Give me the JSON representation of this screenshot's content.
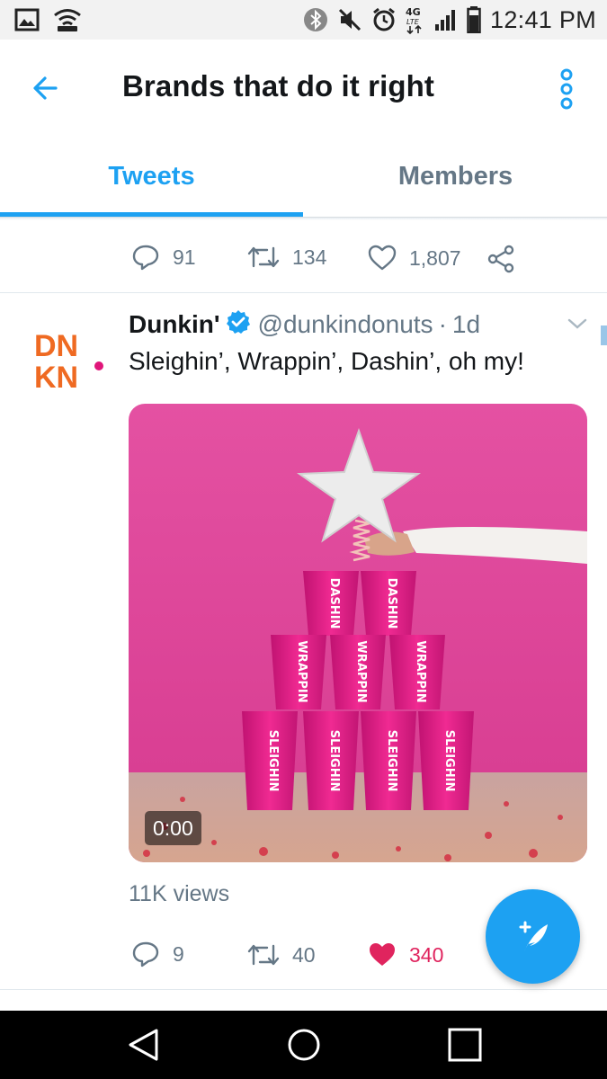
{
  "status_bar": {
    "time": "12:41 PM",
    "network_label": "4G LTE",
    "icons": [
      "image-icon",
      "wifi-hotspot-icon",
      "bluetooth-icon",
      "mute-icon",
      "alarm-icon",
      "network-4g-lte-icon",
      "signal-icon",
      "battery-icon"
    ]
  },
  "header": {
    "title": "Brands that do it right",
    "back_icon": "arrow-left-icon",
    "menu_icon": "more-vertical-icon",
    "accent_color": "#1da1f2"
  },
  "tabs": [
    {
      "label": "Tweets",
      "active": true
    },
    {
      "label": "Members",
      "active": false
    }
  ],
  "previous_tweet_actions": {
    "replies": "91",
    "retweets": "134",
    "likes": "1,807"
  },
  "tweet": {
    "author_name": "Dunkin'",
    "verified": true,
    "handle": "@dunkindonuts",
    "separator": "·",
    "time_ago": "1d",
    "text": "Sleighin’, Wrappin’, Dashin’, oh my!",
    "avatar_logo": {
      "line1": "DN",
      "line2": "KN",
      "tm": "TM",
      "orange": "#ef6a22",
      "pink": "#e0167a"
    },
    "media": {
      "type": "video",
      "duration": "0:00",
      "cup_labels": [
        "DASHIN",
        "DASHIN",
        "WRAPPIN",
        "WRAPPIN",
        "WRAPPIN",
        "SLEIGHIN",
        "SLEIGHIN",
        "SLEIGHIN",
        "SLEIGHIN"
      ],
      "background_color": "#e0479b"
    },
    "views": "11K views",
    "actions": {
      "replies": "9",
      "retweets": "40",
      "likes": "340",
      "liked": true,
      "like_color": "#e0245e"
    }
  },
  "fab": {
    "icon": "compose-tweet-icon"
  },
  "nav_bar": {
    "icons": [
      "back-triangle-icon",
      "home-circle-icon",
      "recents-square-icon"
    ]
  }
}
